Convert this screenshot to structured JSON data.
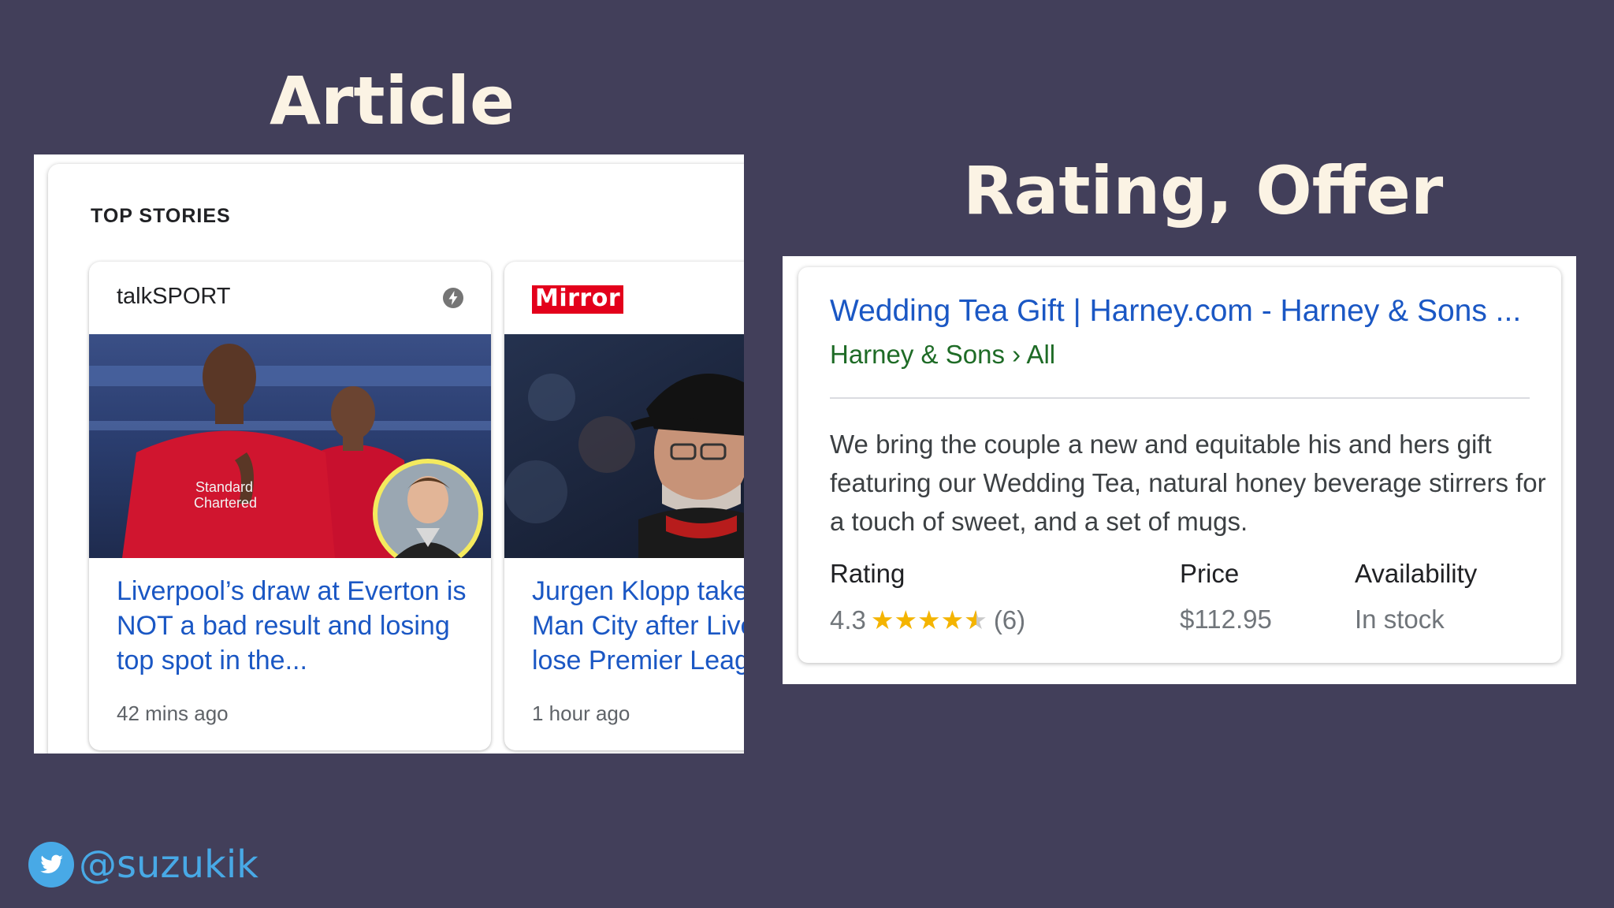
{
  "headings": {
    "article": "Article",
    "rating_offer": "Rating, Offer"
  },
  "top_stories": {
    "section_title": "TOP STORIES",
    "stories": [
      {
        "source": "talkSPORT",
        "headline": "Liverpool’s draw at Everton is NOT a bad result and losing top spot in the...",
        "time": "42 mins ago",
        "has_amp_icon": true
      },
      {
        "source": "Mirror",
        "headline_lines": [
          "Jurgen Klopp takes",
          "Man City after Live",
          "lose Premier Leagu"
        ],
        "time": "1 hour ago"
      }
    ]
  },
  "search_result": {
    "title": "Wedding Tea Gift | Harney.com - Harney & Sons ...",
    "breadcrumb": "Harney & Sons › All",
    "snippet": "We bring the couple a new and equitable his and hers gift featuring our Wedding Tea, natural honey beverage stirrers for a touch of sweet, and a set of mugs.",
    "rating_label": "Rating",
    "rating_value": "4.3",
    "rating_stars_full": "★★★★",
    "rating_star_partial": "★",
    "rating_count": "(6)",
    "price_label": "Price",
    "price_value": "$112.95",
    "availability_label": "Availability",
    "availability_value": "In stock",
    "star_color": "#f4b400"
  },
  "footer": {
    "twitter_handle": "@suzukik",
    "icon": "twitter-bird-icon"
  },
  "colors": {
    "background": "#423f5a",
    "heading": "#fbf3e4",
    "link": "#1a57c4",
    "breadcrumb": "#1e6b26",
    "twitter": "#48a9e6"
  }
}
